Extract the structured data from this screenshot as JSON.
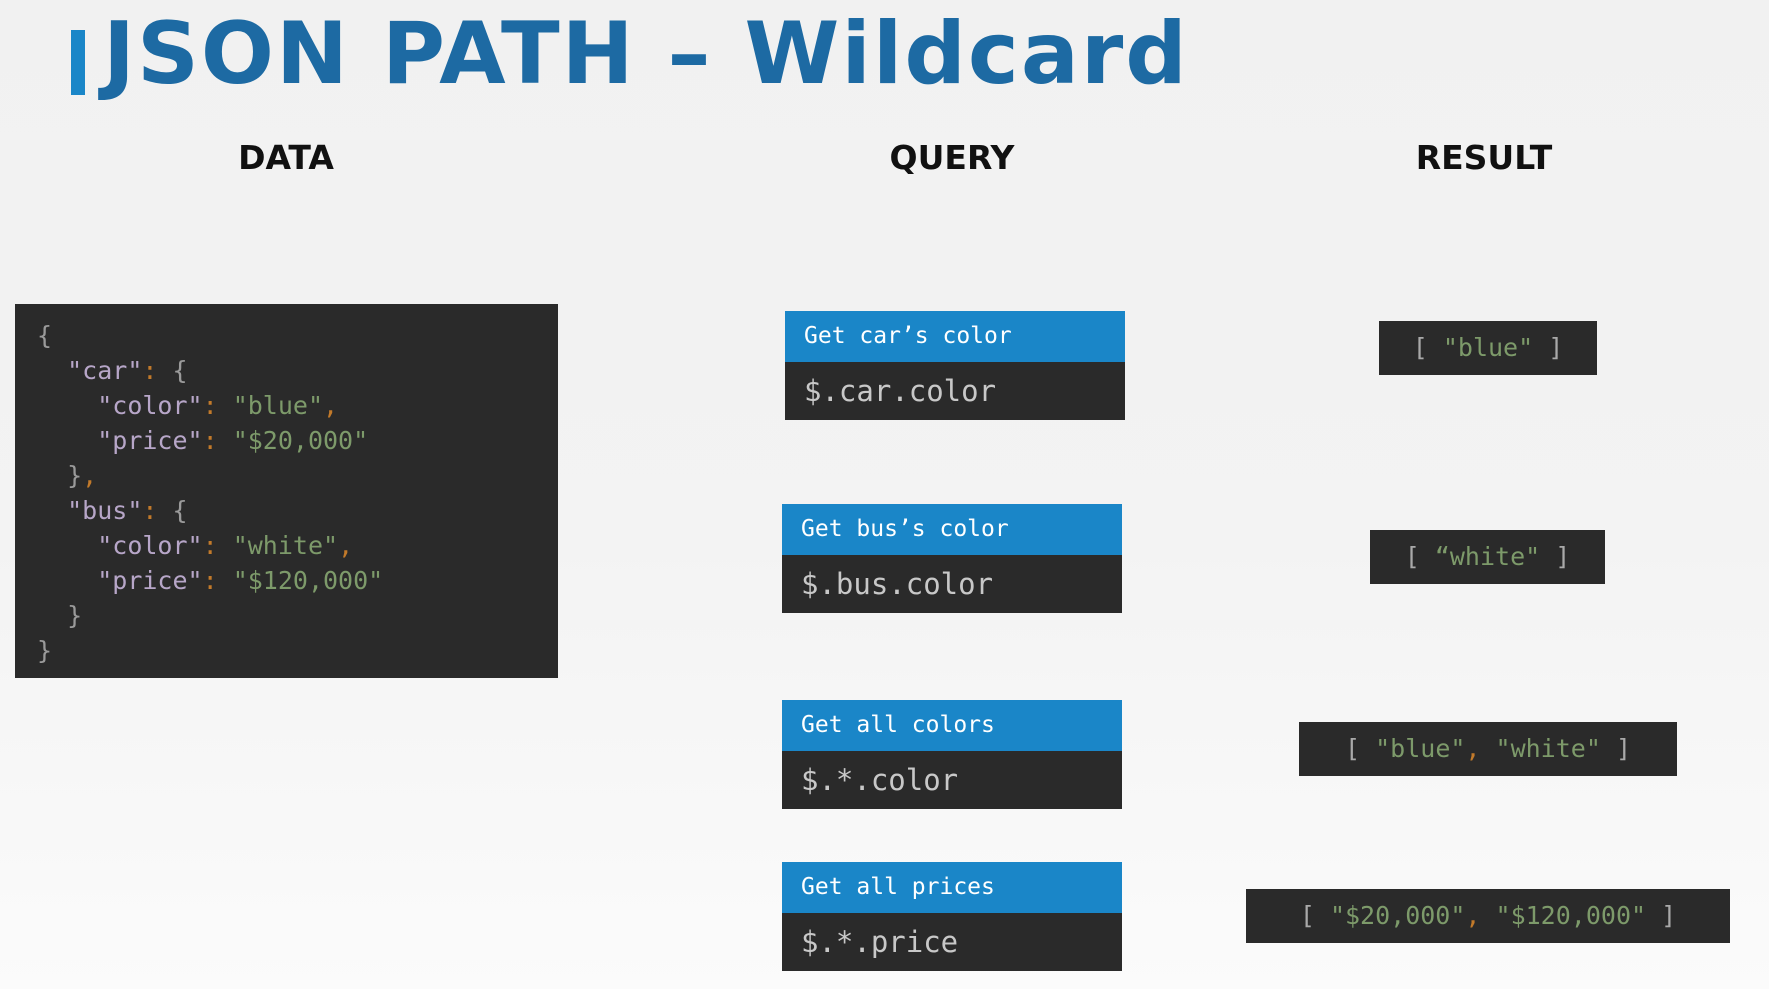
{
  "title": "JSON PATH – Wildcard",
  "columns": {
    "data": "DATA",
    "query": "QUERY",
    "result": "RESULT"
  },
  "data_code": {
    "open": "{",
    "car_key": "\"car\"",
    "color_key": "\"color\"",
    "price_key": "\"price\"",
    "car_color": "\"blue\"",
    "car_price": "\"$20,000\"",
    "bus_key": "\"bus\"",
    "bus_color": "\"white\"",
    "bus_price": "\"$120,000\"",
    "inner_open": "{",
    "inner_close": "}",
    "comma": ",",
    "colon": ":",
    "close": "}"
  },
  "queries": [
    {
      "label": "Get car’s color",
      "expr": "$.car.color"
    },
    {
      "label": "Get bus’s color",
      "expr": "$.bus.color"
    },
    {
      "label": "Get all colors",
      "expr": "$.*.color"
    },
    {
      "label": "Get all prices",
      "expr": "$.*.price"
    }
  ],
  "results": [
    {
      "open": "[ ",
      "items": [
        "\"blue\""
      ],
      "close": " ]"
    },
    {
      "open": "[ ",
      "items": [
        "“white\""
      ],
      "close": " ]"
    },
    {
      "open": "[ ",
      "items": [
        "\"blue\"",
        "\"white\""
      ],
      "close": " ]"
    },
    {
      "open": "[ ",
      "items": [
        "\"$20,000\"",
        "\"$120,000\""
      ],
      "close": " ]"
    }
  ],
  "result_separator": ", ",
  "colors": {
    "accent": "#1a86c8",
    "title": "#1d6aa3",
    "code_bg": "#2a2a2a"
  }
}
